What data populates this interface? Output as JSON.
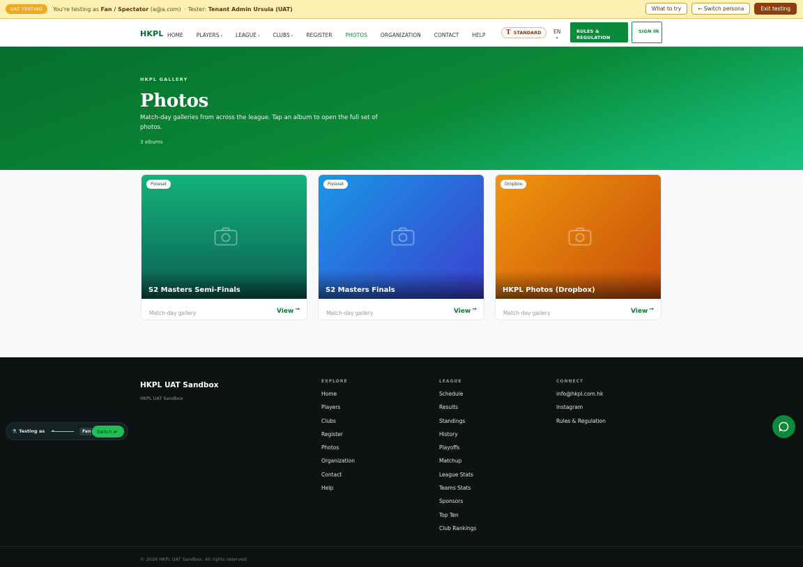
{
  "uat_banner": {
    "badge": "UAT TESTING",
    "prefix": "You're testing as",
    "persona": "Fan / Spectator",
    "email": "(a@a.com)",
    "tester_prefix": "· Tester:",
    "tester": "Tenant Admin Ursula (UAT)",
    "actions": {
      "what_to_try": "What to try",
      "switch_persona": "← Switch persona",
      "exit_testing": "Exit testing"
    }
  },
  "nav": {
    "brand": "HKPL",
    "links": [
      {
        "label": "HOME",
        "has_caret": false
      },
      {
        "label": "PLAYERS",
        "has_caret": true
      },
      {
        "label": "LEAGUE",
        "has_caret": true
      },
      {
        "label": "CLUBS",
        "has_caret": true
      },
      {
        "label": "REGISTER",
        "has_caret": false
      },
      {
        "label": "PHOTOS",
        "has_caret": false,
        "active": true
      },
      {
        "label": "ORGANIZATION",
        "has_caret": false
      },
      {
        "label": "CONTACT",
        "has_caret": false
      },
      {
        "label": "HELP",
        "has_caret": false
      }
    ],
    "caret": "▾",
    "text_size_label": "STANDARD",
    "text_size_icon": "T",
    "language": "EN",
    "rules_button": "RULES & REGULATION",
    "signin_button": "SIGN IN"
  },
  "hero": {
    "eyebrow": "HKPL GALLERY",
    "title": "Photos",
    "description": "Match-day galleries from across the league. Tap an album to open the full set of photos.",
    "count": "3 albums"
  },
  "albums": [
    {
      "source": "Pixieset",
      "title": "S2 Masters Semi-Finals",
      "subtitle": "Match-day gallery",
      "view_label": "View",
      "gradient": [
        "#13b27a",
        "#0b5f52"
      ]
    },
    {
      "source": "Pixieset",
      "title": "S2 Masters Finals",
      "subtitle": "Match-day gallery",
      "view_label": "View",
      "gradient": [
        "#1a96e6",
        "#3b3fd0"
      ]
    },
    {
      "source": "Dropbox",
      "title": "HKPL Photos (Dropbox)",
      "subtitle": "Match-day gallery",
      "view_label": "View",
      "gradient": [
        "#f0960d",
        "#c84d0a"
      ]
    }
  ],
  "footer": {
    "brand": "HKPL UAT Sandbox",
    "brand_sub": "HKPL UAT Sandbox",
    "columns": [
      {
        "title": "EXPLORE",
        "items": [
          "Home",
          "Players",
          "Clubs",
          "Register",
          "Photos",
          "Organization",
          "Contact",
          "Help"
        ]
      },
      {
        "title": "LEAGUE",
        "items": [
          "Schedule",
          "Results",
          "Standings",
          "History",
          "Playoffs",
          "Matchup",
          "League Stats",
          "Teams Stats",
          "Sponsors",
          "Top Ten",
          "Club Rankings"
        ]
      },
      {
        "title": "CONNECT",
        "items": [
          "info@hkpl.com.hk",
          "Instagram",
          "Rules & Regulation"
        ]
      }
    ],
    "copyright": "© 2026 HKPL UAT Sandbox. All rights reserved."
  },
  "persona_switcher": {
    "icon": "test-tube-icon",
    "label": "Testing as",
    "role": "Fan",
    "switch_label": "Switch ⇄"
  },
  "chat": {
    "icon": "chat-bubble-icon"
  },
  "colors": {
    "brand_green": "#0a8a3a",
    "uat_banner_bg": "#fdf1b4",
    "footer_bg": "#0d1212"
  }
}
